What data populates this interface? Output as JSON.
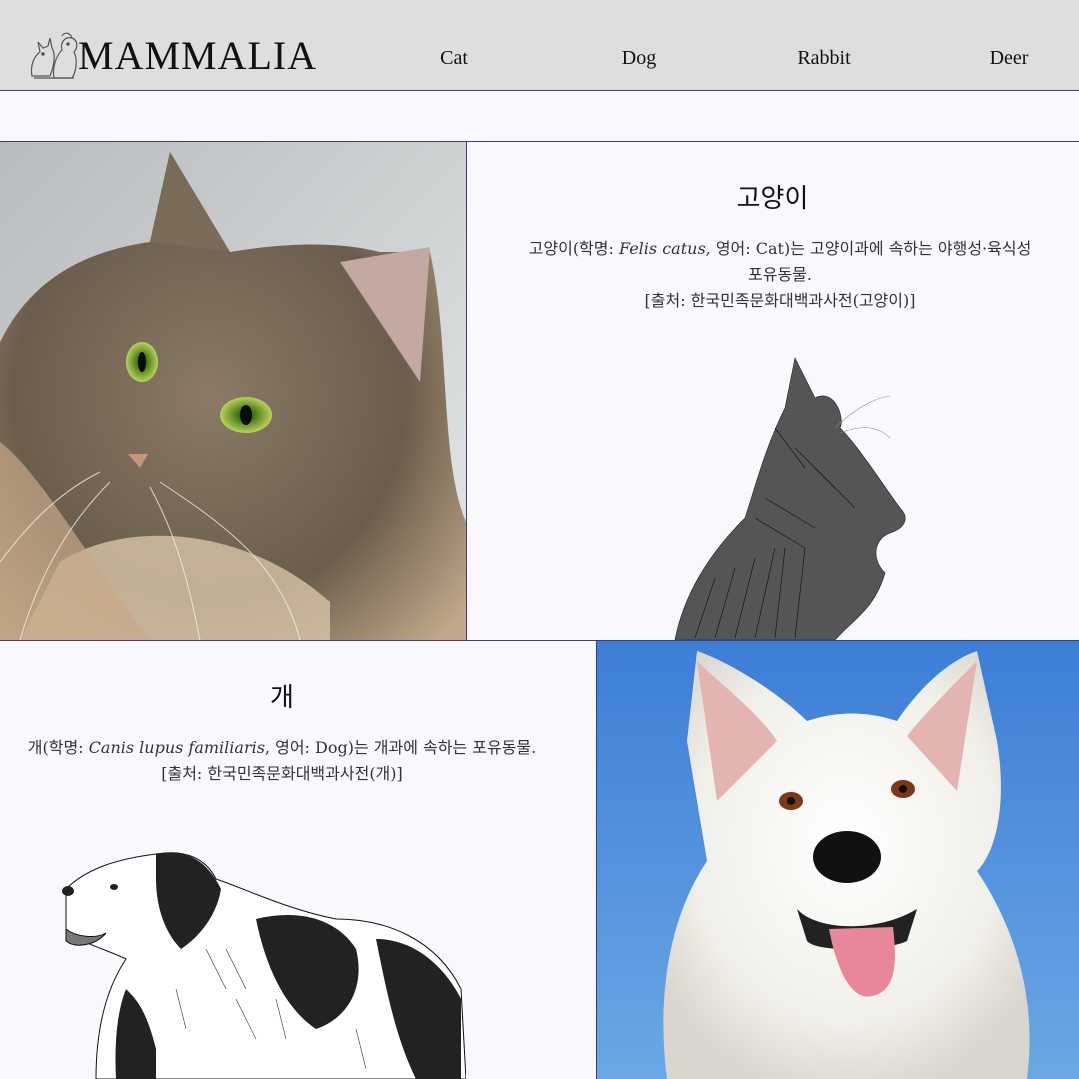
{
  "header": {
    "brand": "MAMMALIA",
    "logo_icon": "cat-and-dog-logo-icon",
    "nav": [
      {
        "label": "Cat"
      },
      {
        "label": "Dog"
      },
      {
        "label": "Rabbit"
      },
      {
        "label": "Deer"
      }
    ]
  },
  "cat": {
    "title": "고양이",
    "desc_prefix": "고양이(학명: ",
    "desc_italic": "Felis catus",
    "desc_suffix": ", 영어: Cat)는 고양이과에 속하는 야행성·육식성 포유동물.",
    "source": "[출처: 한국민족문화대백과사전(고양이)]",
    "photo_icon": "cat-photo",
    "sketch_icon": "cat-sketch"
  },
  "dog": {
    "title": "개",
    "desc_prefix": "개(학명: ",
    "desc_italic": "Canis lupus familiaris",
    "desc_suffix": ", 영어: Dog)는 개과에 속하는 포유동물.",
    "source": "[출처: 한국민족문화대백과사전(개)]",
    "photo_icon": "dog-photo",
    "sketch_icon": "dog-sketch"
  },
  "colors": {
    "header_bg": "#dedede",
    "border": "#3d3a8a",
    "page_bg": "#f8f8fd",
    "sky": "#4a8fd8"
  }
}
